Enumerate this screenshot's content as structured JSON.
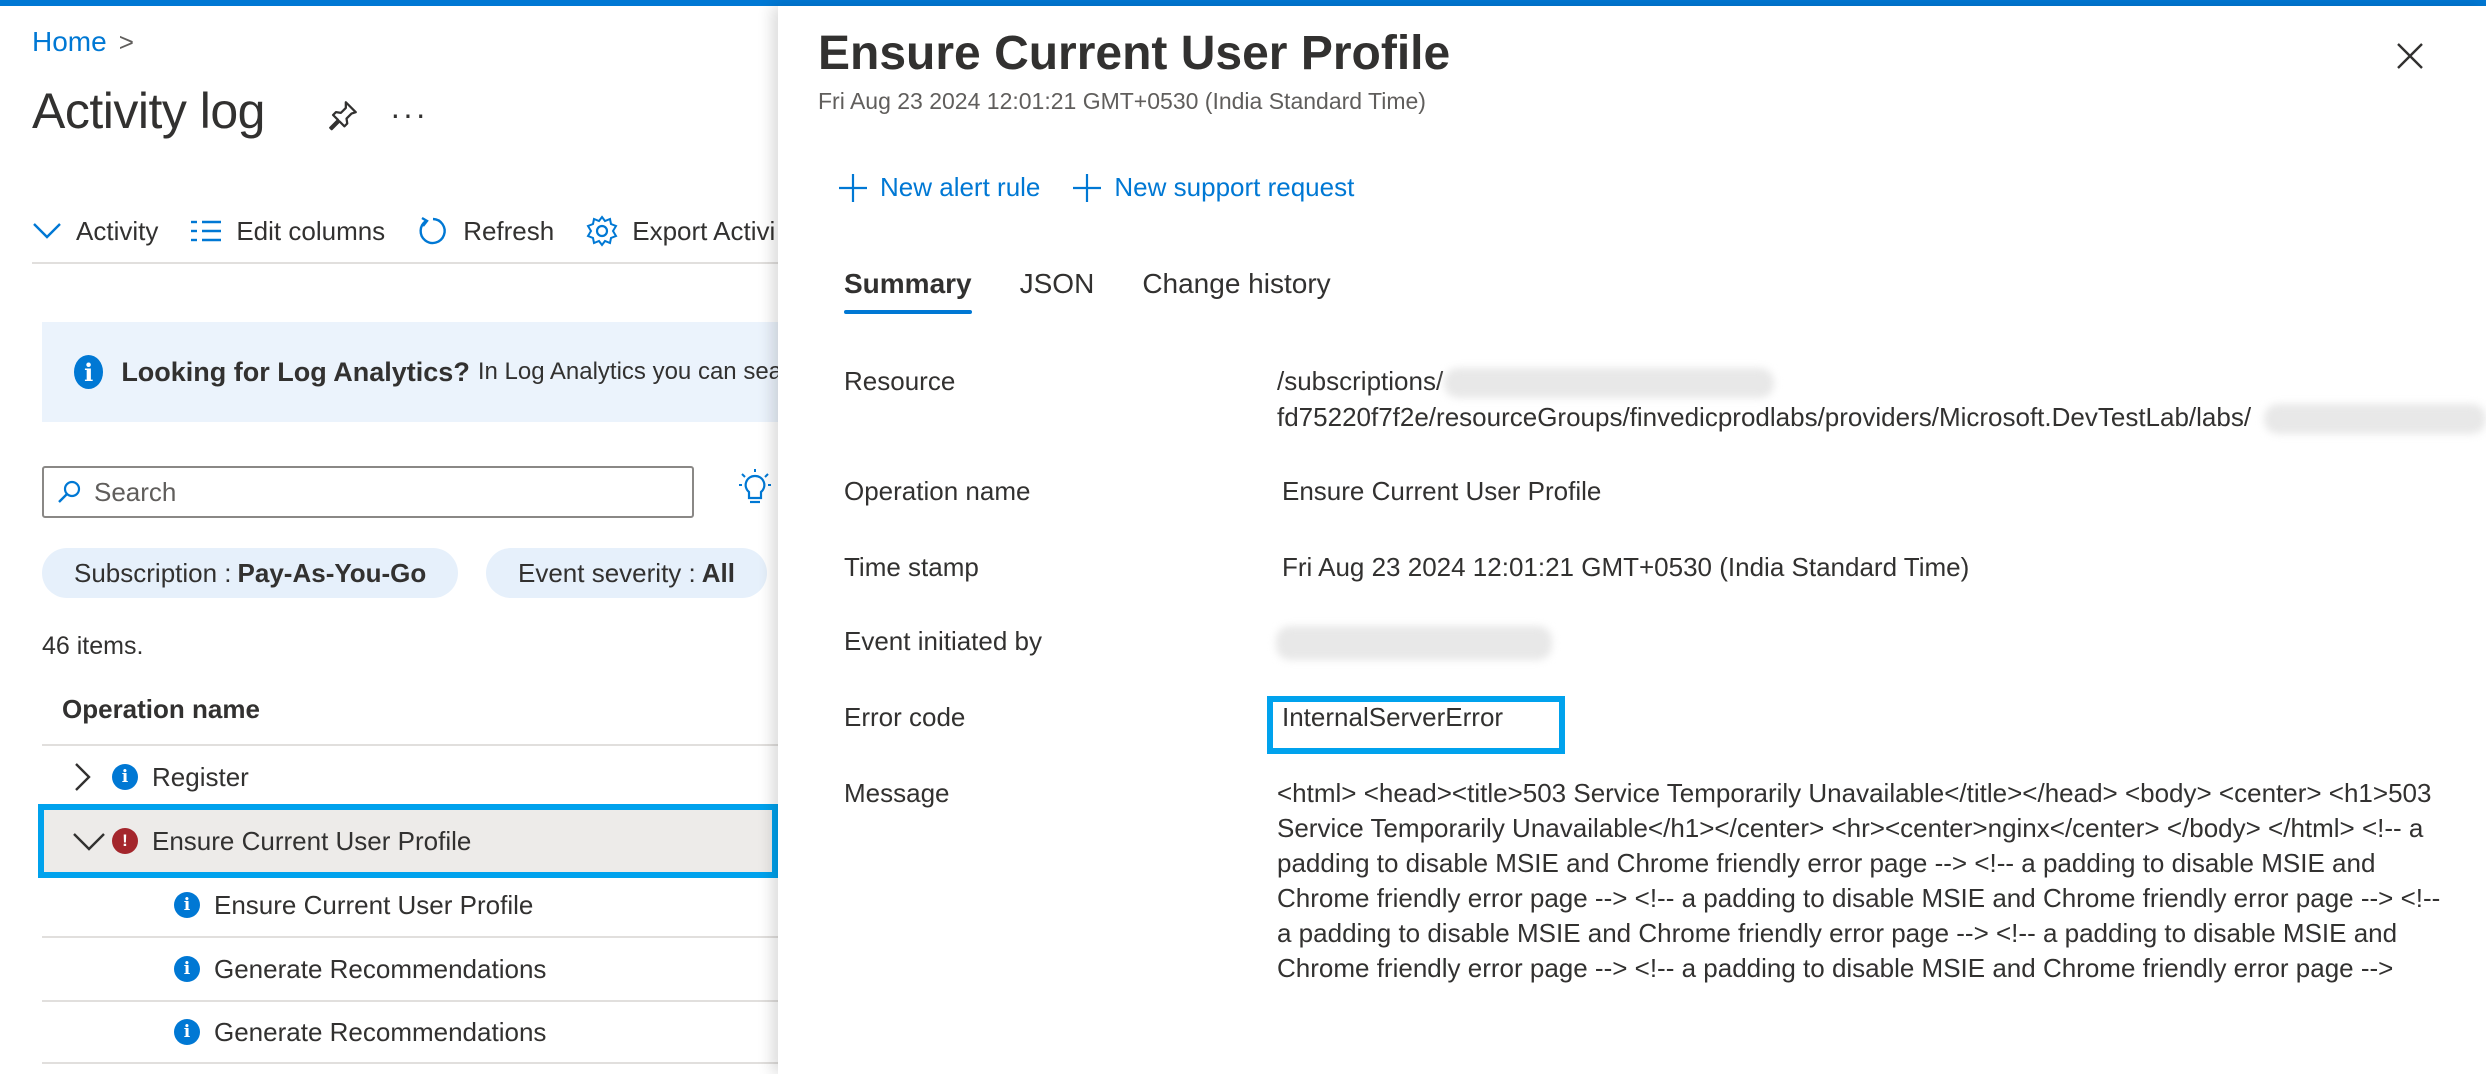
{
  "colors": {
    "accent": "#0078d4",
    "highlight": "#00a2ed",
    "error": "#a4262c"
  },
  "left": {
    "breadcrumb": {
      "home": "Home",
      "separator": ">"
    },
    "title": "Activity log",
    "toolbar": {
      "activity": "Activity",
      "edit_columns": "Edit columns",
      "refresh": "Refresh",
      "export": "Export Activi"
    },
    "banner": {
      "title": "Looking for Log Analytics?",
      "text": "In Log Analytics you can searc"
    },
    "search": {
      "placeholder": "Search"
    },
    "filters": {
      "subscription_label": "Subscription :",
      "subscription_value": "Pay-As-You-Go",
      "severity_label": "Event severity :",
      "severity_value": "All"
    },
    "items_count": "46 items.",
    "column_header": "Operation name",
    "rows": [
      {
        "label": "Register",
        "icon": "info-icon",
        "expanded": false
      },
      {
        "label": "Ensure Current User Profile",
        "icon": "error-icon",
        "expanded": true
      },
      {
        "label": "Ensure Current User Profile",
        "icon": "info-icon"
      },
      {
        "label": "Generate Recommendations",
        "icon": "info-icon"
      },
      {
        "label": "Generate Recommendations",
        "icon": "info-icon"
      }
    ]
  },
  "panel": {
    "title": "Ensure Current User Profile",
    "subtitle": "Fri Aug 23 2024 12:01:21 GMT+0530 (India Standard Time)",
    "commands": {
      "new_alert": "New alert rule",
      "new_support": "New support request"
    },
    "tabs": [
      "Summary",
      "JSON",
      "Change history"
    ],
    "fields": {
      "resource_label": "Resource",
      "resource_line1": "/subscriptions/",
      "resource_line2": "fd75220f7f2e/resourceGroups/finvedicprodlabs/providers/Microsoft.DevTestLab/labs/",
      "operation_label": "Operation name",
      "operation_value": "Ensure Current User Profile",
      "timestamp_label": "Time stamp",
      "timestamp_value": "Fri Aug 23 2024 12:01:21 GMT+0530 (India Standard Time)",
      "initiated_label": "Event initiated by",
      "error_label": "Error code",
      "error_value": "InternalServerError",
      "message_label": "Message",
      "message_value": "<html> <head><title>503 Service Temporarily Unavailable</title></head> <body> <center> <h1>503 Service Temporarily Unavailable</h1></center> <hr><center>nginx</center> </body> </html> <!-- a padding to disable MSIE and Chrome friendly error page --> <!-- a padding to disable MSIE and Chrome friendly error page --> <!-- a padding to disable MSIE and Chrome friendly error page --> <!-- a padding to disable MSIE and Chrome friendly error page --> <!-- a padding to disable MSIE and Chrome friendly error page --> <!-- a padding to disable MSIE and Chrome friendly error page -->"
    }
  }
}
